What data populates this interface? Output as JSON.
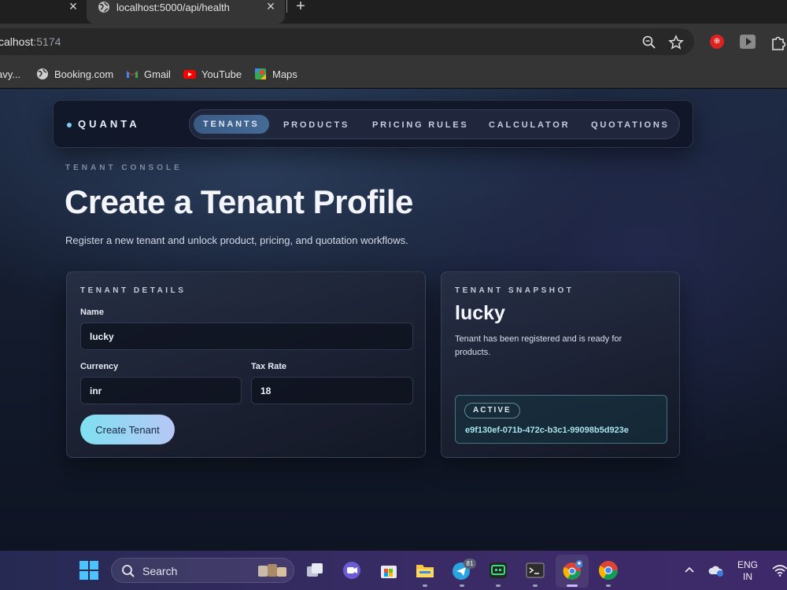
{
  "browser": {
    "tab_title": "localhost:5000/api/health",
    "url_host": "calhost",
    "url_port": ":5174",
    "bookmarks": [
      {
        "label": "avy..."
      },
      {
        "label": "Booking.com"
      },
      {
        "label": "Gmail"
      },
      {
        "label": "YouTube"
      },
      {
        "label": "Maps"
      }
    ]
  },
  "app": {
    "brand": "QUANTA",
    "nav": [
      {
        "label": "TENANTS",
        "active": true
      },
      {
        "label": "PRODUCTS",
        "active": false
      },
      {
        "label": "PRICING RULES",
        "active": false
      },
      {
        "label": "CALCULATOR",
        "active": false
      },
      {
        "label": "QUOTATIONS",
        "active": false
      }
    ],
    "eyebrow": "TENANT CONSOLE",
    "title": "Create a Tenant Profile",
    "subtitle": "Register a new tenant and unlock product, pricing, and quotation workflows.",
    "details": {
      "heading": "TENANT DETAILS",
      "name_label": "Name",
      "name_value": "lucky",
      "currency_label": "Currency",
      "currency_value": "inr",
      "tax_label": "Tax Rate",
      "tax_value": "18",
      "submit_label": "Create Tenant"
    },
    "snapshot": {
      "heading": "TENANT SNAPSHOT",
      "name": "lucky",
      "description": "Tenant has been registered and is ready for products.",
      "status": "ACTIVE",
      "tenant_id": "e9f130ef-071b-472c-b3c1-99098b5d923e"
    }
  },
  "taskbar": {
    "search_label": "Search",
    "telegram_badge": "81",
    "lang_line1": "ENG",
    "lang_line2": "IN"
  },
  "colors": {
    "accent_cyan": "#7fe0f2",
    "nav_active": "#3a5b84",
    "taskbar_purple": "#3a2b66"
  }
}
